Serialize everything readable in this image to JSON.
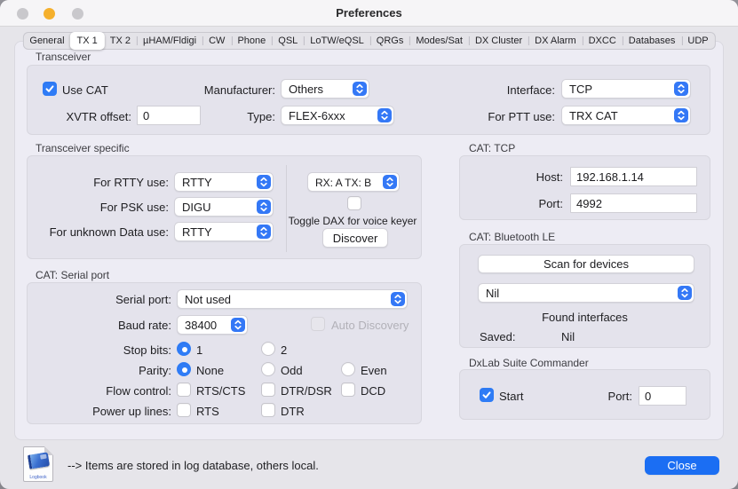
{
  "window": {
    "title": "Preferences"
  },
  "tabs": {
    "selected": "TX 1",
    "items": [
      "General",
      "TX 1",
      "TX 2",
      "µHAM/Fldigi",
      "CW",
      "Phone",
      "QSL",
      "LoTW/eQSL",
      "QRGs",
      "Modes/Sat",
      "DX Cluster",
      "DX Alarm",
      "DXCC",
      "Databases",
      "UDP"
    ]
  },
  "transceiver": {
    "title": "Transceiver",
    "use_cat_label": "Use CAT",
    "use_cat_checked": true,
    "manufacturer_label": "Manufacturer:",
    "manufacturer_value": "Others",
    "interface_label": "Interface:",
    "interface_value": "TCP",
    "xvtr_offset_label": "XVTR offset:",
    "xvtr_offset_value": "0",
    "type_label": "Type:",
    "type_value": "FLEX-6xxx",
    "ptt_label": "For PTT use:",
    "ptt_value": "TRX CAT"
  },
  "transceiver_specific": {
    "title": "Transceiver specific",
    "rtty_label": "For RTTY use:",
    "rtty_value": "RTTY",
    "psk_label": "For PSK use:",
    "psk_value": "DIGU",
    "unknown_data_label": "For unknown Data use:",
    "unknown_data_value": "RTTY",
    "rx_tx_value": "RX: A TX: B",
    "toggle_dax_label": "Toggle DAX for voice keyer",
    "toggle_dax_checked": false,
    "discover_label": "Discover"
  },
  "cat_tcp": {
    "title": "CAT: TCP",
    "host_label": "Host:",
    "host_value": "192.168.1.14",
    "port_label": "Port:",
    "port_value": "4992"
  },
  "cat_serial": {
    "title": "CAT: Serial port",
    "serial_port_label": "Serial port:",
    "serial_port_value": "Not used",
    "baud_label": "Baud rate:",
    "baud_value": "38400",
    "auto_discovery_label": "Auto Discovery",
    "auto_discovery_enabled": false,
    "stop_bits_label": "Stop bits:",
    "stop_bits": {
      "selected": "1",
      "options": [
        "1",
        "2"
      ]
    },
    "parity_label": "Parity:",
    "parity": {
      "selected": "None",
      "options": [
        "None",
        "Odd",
        "Even"
      ]
    },
    "flow_label": "Flow control:",
    "flow_options": [
      "RTS/CTS",
      "DTR/DSR",
      "DCD"
    ],
    "power_label": "Power up lines:",
    "power_options": [
      "RTS",
      "DTR"
    ]
  },
  "cat_bluetooth": {
    "title": "CAT: Bluetooth LE",
    "scan_label": "Scan for devices",
    "device_value": "Nil",
    "found_label": "Found interfaces",
    "saved_label": "Saved:",
    "saved_value": "Nil"
  },
  "dxlab": {
    "title": "DxLab Suite Commander",
    "start_label": "Start",
    "start_checked": true,
    "port_label": "Port:",
    "port_value": "0"
  },
  "footer": {
    "icon_caption": "Logbook",
    "note": "--> Items are stored in log database, others local.",
    "close_label": "Close"
  },
  "colors": {
    "accent_blue": "#3478f6",
    "checked_blue": "#2f7cf6",
    "close_button_blue": "#1b6ef3",
    "minimize_light_yellow": "#f5b02d"
  }
}
